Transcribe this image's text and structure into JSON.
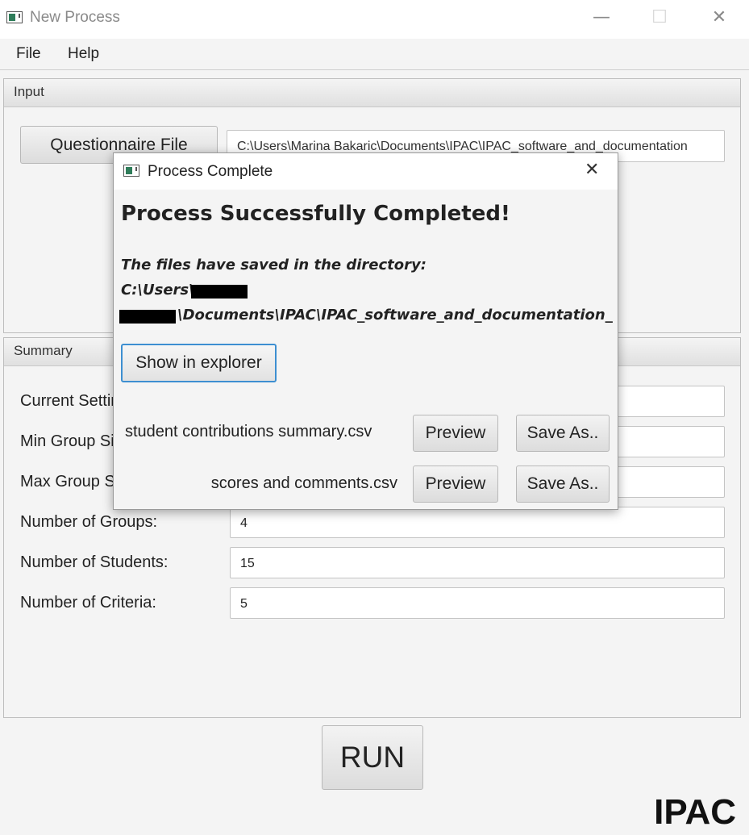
{
  "window": {
    "title": "New Process",
    "controls": {
      "minimize": "—",
      "maximize": "☐",
      "close": "✕"
    }
  },
  "menu": [
    {
      "label": "File"
    },
    {
      "label": "Help"
    }
  ],
  "input_panel": {
    "title": "Input",
    "questionnaire_button": "Questionnaire File",
    "file_path": "C:\\Users\\Marina Bakaric\\Documents\\IPAC\\IPAC_software_and_documentation"
  },
  "summary_panel": {
    "title": "Summary",
    "fields": [
      {
        "label": "Current Settings:",
        "value": ""
      },
      {
        "label": "Min Group Size:",
        "value": ""
      },
      {
        "label": "Max Group Size:",
        "value": ""
      },
      {
        "label": "Number of Groups:",
        "value": "4"
      },
      {
        "label": "Number of Students:",
        "value": "15"
      },
      {
        "label": "Number of Criteria:",
        "value": "5"
      }
    ]
  },
  "run_button": "RUN",
  "brand": "IPAC",
  "dialog": {
    "title": "Process Complete",
    "close": "✕",
    "heading": "Process Successfully Completed!",
    "dir_label": "The files have saved in the directory:",
    "path_line1": "C:\\Users\\",
    "path_line2": "\\Documents\\IPAC\\IPAC_software_and_documentation_v...",
    "show_button": "Show in explorer",
    "files": [
      {
        "name": "student contributions summary.csv",
        "preview": "Preview",
        "save": "Save As.."
      },
      {
        "name": "scores and comments.csv",
        "preview": "Preview",
        "save": "Save As.."
      }
    ]
  }
}
